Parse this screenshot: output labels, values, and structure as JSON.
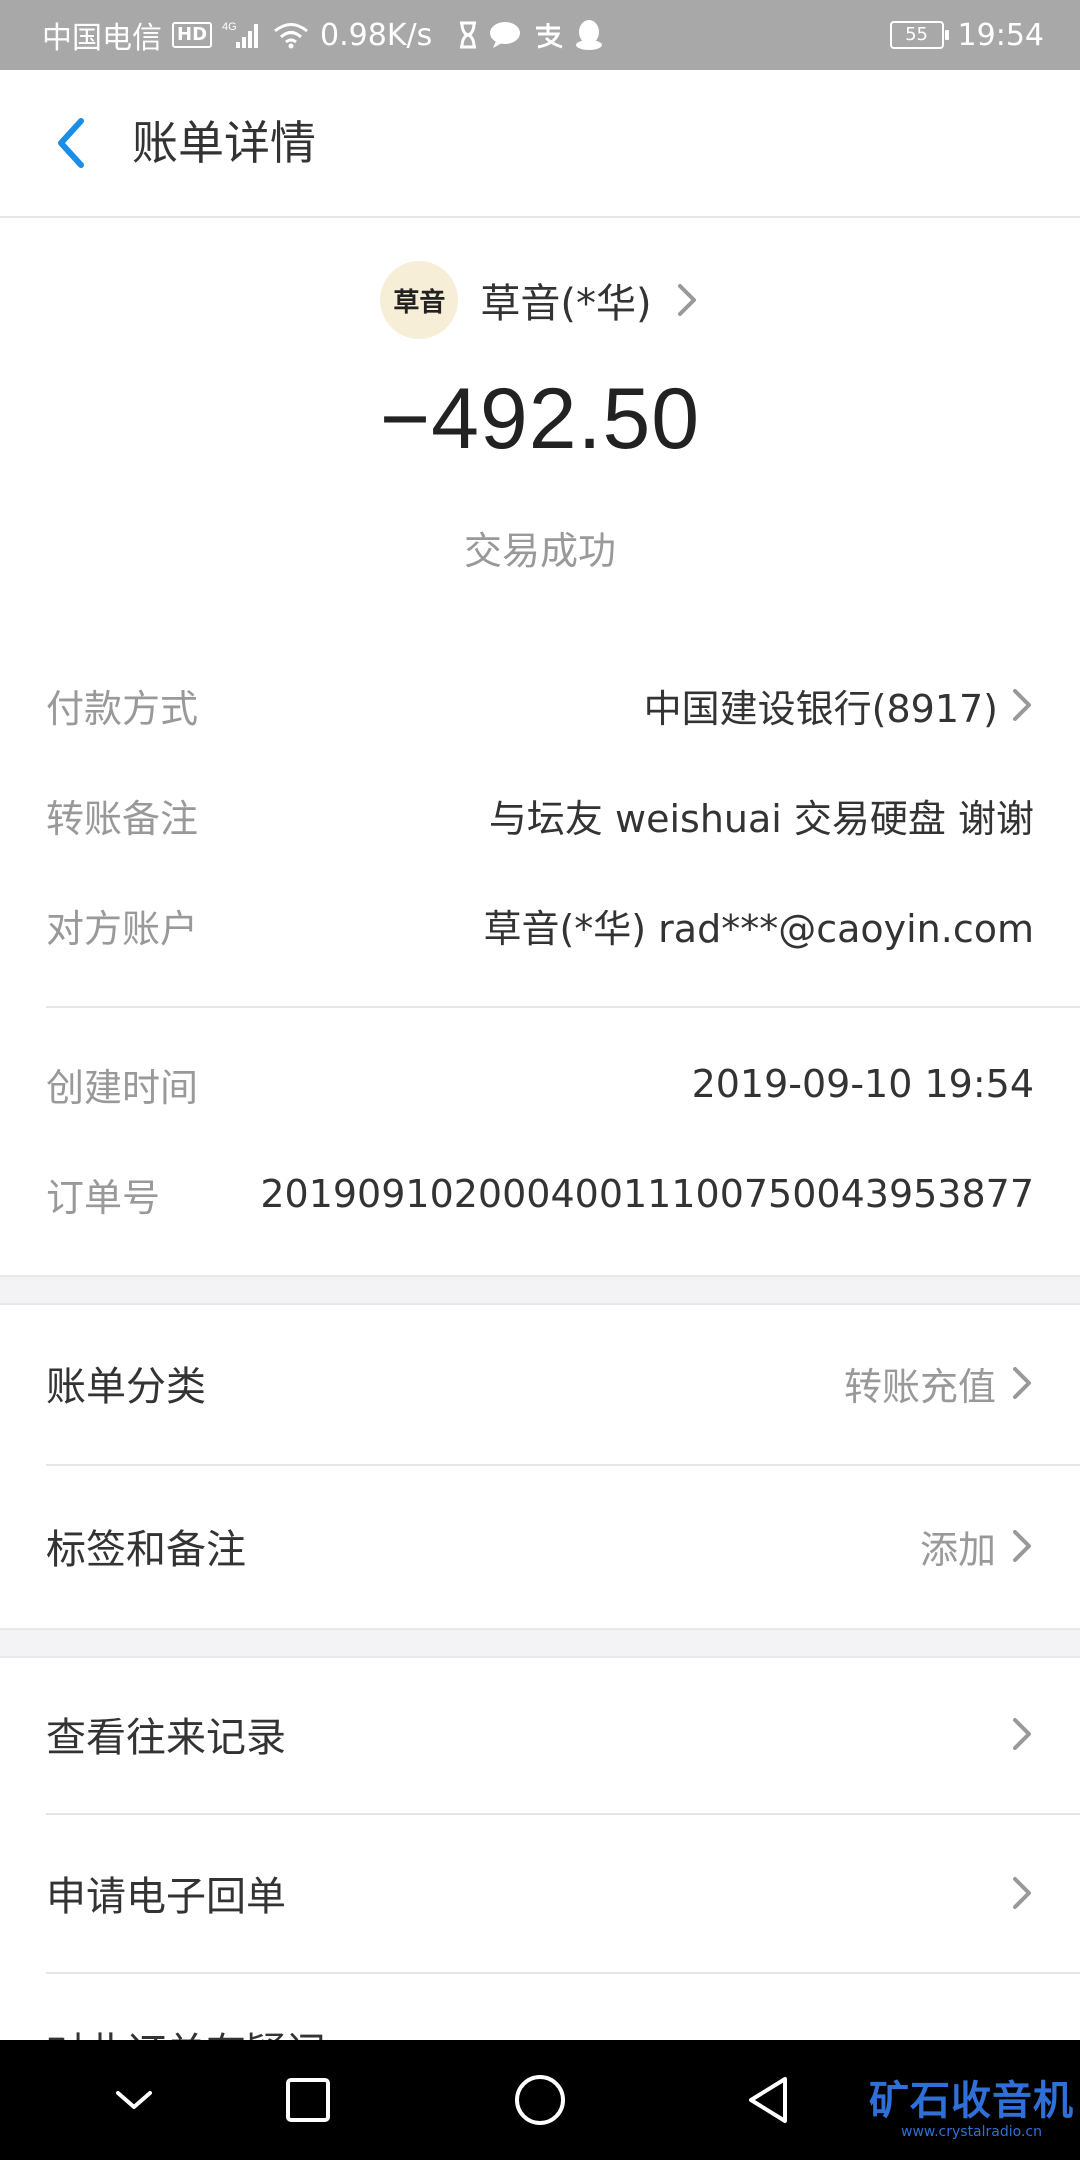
{
  "status_bar": {
    "carrier": "中国电信",
    "hd": "HD",
    "network": "4G",
    "speed": "0.98K/s",
    "battery": "55",
    "time": "19:54"
  },
  "header": {
    "title": "账单详情"
  },
  "payee": {
    "avatar_text": "草音",
    "name": "草音(*华)"
  },
  "amount": "−492.50",
  "status": "交易成功",
  "details": {
    "payment_method_label": "付款方式",
    "payment_method_value": "中国建设银行(8917)",
    "note_label": "转账备注",
    "note_value": "与坛友 weishuai 交易硬盘 谢谢",
    "counterparty_label": "对方账户",
    "counterparty_value": "草音(*华) rad***@caoyin.com",
    "created_label": "创建时间",
    "created_value": "2019-09-10 19:54",
    "order_label": "订单号",
    "order_value": "20190910200040011100750043953877"
  },
  "menu": {
    "category_label": "账单分类",
    "category_value": "转账充值",
    "tags_label": "标签和备注",
    "tags_value": "添加",
    "history_label": "查看往来记录",
    "receipt_label": "申请电子回单",
    "question_label": "对此订单有疑问"
  },
  "watermark": {
    "main": "矿石收音机",
    "sub": "www.crystalradio.cn"
  },
  "colors": {
    "accent": "#1a8ee6",
    "status_bar_bg": "#a8a8a8",
    "band_bg": "#f3f3f5"
  },
  "icons": {
    "back": "chevron-left-icon",
    "row_arrow": "chevron-right-icon"
  }
}
